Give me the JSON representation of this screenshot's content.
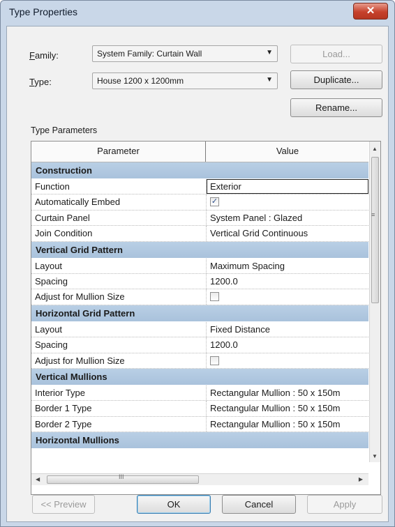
{
  "window": {
    "title": "Type Properties",
    "close_glyph": "✕"
  },
  "family": {
    "label_key": "F",
    "label_rest": "amily:",
    "value": "System Family: Curtain Wall"
  },
  "type": {
    "label_key": "T",
    "label_rest": "ype:",
    "value": "House 1200 x 1200mm"
  },
  "buttons": {
    "load": "Load...",
    "duplicate": "Duplicate...",
    "rename": "Rename...",
    "preview": "<< Preview",
    "ok": "OK",
    "cancel": "Cancel",
    "apply": "Apply"
  },
  "type_parameters_label": "Type Parameters",
  "grid": {
    "header_parameter": "Parameter",
    "header_value": "Value",
    "rows": [
      {
        "kind": "group",
        "label": "Construction"
      },
      {
        "kind": "text",
        "parameter": "Function",
        "value": "Exterior",
        "selected": true
      },
      {
        "kind": "check",
        "parameter": "Automatically Embed",
        "checked": true
      },
      {
        "kind": "text",
        "parameter": "Curtain Panel",
        "value": "System Panel : Glazed"
      },
      {
        "kind": "text",
        "parameter": "Join Condition",
        "value": "Vertical Grid Continuous"
      },
      {
        "kind": "group",
        "label": "Vertical Grid Pattern"
      },
      {
        "kind": "text",
        "parameter": "Layout",
        "value": "Maximum Spacing"
      },
      {
        "kind": "text",
        "parameter": "Spacing",
        "value": "1200.0"
      },
      {
        "kind": "check",
        "parameter": "Adjust for Mullion Size",
        "checked": false
      },
      {
        "kind": "group",
        "label": "Horizontal Grid Pattern"
      },
      {
        "kind": "text",
        "parameter": "Layout",
        "value": "Fixed Distance"
      },
      {
        "kind": "text",
        "parameter": "Spacing",
        "value": "1200.0"
      },
      {
        "kind": "check",
        "parameter": "Adjust for Mullion Size",
        "checked": false
      },
      {
        "kind": "group",
        "label": "Vertical Mullions"
      },
      {
        "kind": "text",
        "parameter": "Interior Type",
        "value": "Rectangular Mullion : 50 x 150m"
      },
      {
        "kind": "text",
        "parameter": "Border 1 Type",
        "value": "Rectangular Mullion : 50 x 150m"
      },
      {
        "kind": "text",
        "parameter": "Border 2 Type",
        "value": "Rectangular Mullion : 50 x 150m"
      },
      {
        "kind": "group",
        "label": "Horizontal Mullions"
      }
    ]
  },
  "icons": {
    "combo_arrow": "▼",
    "scroll_up": "▲",
    "scroll_down": "▼",
    "scroll_left": "◀",
    "scroll_right": "▶",
    "grip_vertical": "≡",
    "grip_horizontal": "III",
    "checkmark": "✓"
  },
  "colors": {
    "group_band": "#b9cfe5",
    "window_frame": "#c9d7e8",
    "close_red": "#c6412c"
  }
}
